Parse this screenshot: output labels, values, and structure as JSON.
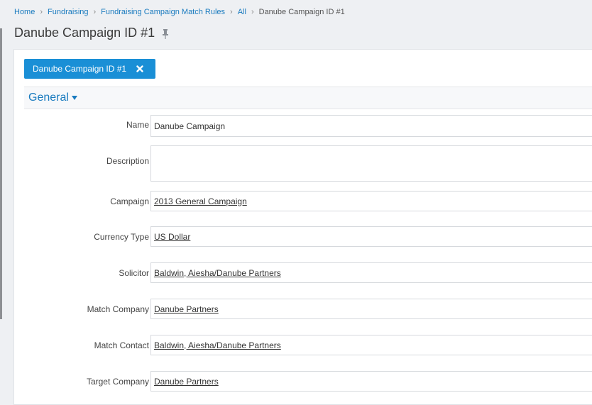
{
  "breadcrumb": {
    "items": [
      "Home",
      "Fundraising",
      "Fundraising Campaign Match Rules",
      "All"
    ],
    "current": "Danube Campaign ID #1"
  },
  "page": {
    "title": "Danube Campaign ID #1",
    "pin_icon": "pin-icon"
  },
  "record_tab": {
    "label": "Danube Campaign ID #1",
    "close_icon": "close-icon",
    "color": "#1a8fd6"
  },
  "section": {
    "title": "General",
    "icon": "caret-down-icon"
  },
  "fields": {
    "name": {
      "label": "Name",
      "value": "Danube Campaign"
    },
    "description": {
      "label": "Description",
      "value": ""
    },
    "campaign": {
      "label": "Campaign",
      "value": "2013 General Campaign"
    },
    "currency_type": {
      "label": "Currency Type",
      "value": "US Dollar"
    },
    "solicitor": {
      "label": "Solicitor",
      "value": "Baldwin, Aiesha/Danube Partners"
    },
    "match_company": {
      "label": "Match Company",
      "value": "Danube Partners"
    },
    "match_contact": {
      "label": "Match Contact",
      "value": "Baldwin, Aiesha/Danube Partners"
    },
    "target_company": {
      "label": "Target Company",
      "value": "Danube Partners"
    }
  },
  "colors": {
    "link": "#1a7bbf",
    "background": "#eef0f3"
  }
}
